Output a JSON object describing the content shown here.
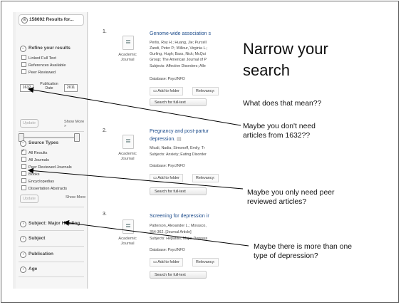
{
  "slide": {
    "headline_line1": "Narrow your",
    "headline_line2": "search",
    "question": "What does that mean??",
    "callouts": [
      {
        "line1": "Maybe you don't need",
        "line2": "articles from 1632??"
      },
      {
        "line1": "Maybe you only need peer",
        "line2": "reviewed articles?"
      },
      {
        "line1": "Maybe there is more than one",
        "line2": "type of depression?"
      }
    ]
  },
  "sidebar": {
    "results_count": "158692 Results for...",
    "refine_heading": "Refine your results",
    "refine_options": [
      {
        "label": "Linked Full Text",
        "checked": false
      },
      {
        "label": "References Available",
        "checked": false
      },
      {
        "label": "Peer Reviewed",
        "checked": false
      }
    ],
    "date_from": "1632",
    "date_label_line1": "Publication",
    "date_label_line2": "Date",
    "date_to": "2011",
    "update_label": "Update",
    "show_more_1": "Show More »",
    "source_types_heading": "Source Types",
    "source_types": [
      {
        "label": "All Results",
        "checked": true
      },
      {
        "label": "All Journals",
        "checked": false
      },
      {
        "label": "Peer Reviewed Journals",
        "checked": false
      },
      {
        "label": "Books",
        "checked": false
      },
      {
        "label": "Encyclopedias",
        "checked": false
      },
      {
        "label": "Dissertation Abstracts",
        "checked": false
      }
    ],
    "show_more_2": "Show More",
    "facets": [
      {
        "label": "Subject: Major Heading"
      },
      {
        "label": "Subject"
      },
      {
        "label": "Publication"
      },
      {
        "label": "Age"
      }
    ]
  },
  "results": [
    {
      "num": "1.",
      "type_line1": "Academic",
      "type_line2": "Journal",
      "title_line1": "Genome-wide association s",
      "meta_lines": [
        "Perlis, Roy H.; Huang, Jie; Purcell",
        "Zandi, Peter P.; Willour, Virginia L.;",
        "Gurling, Hugh; Bass, Nick; McQui",
        "Group; The American Journal of P",
        "Subjects: Affective Disorders; Alle"
      ],
      "database": "Database: PsycINFO",
      "add_folder": "Add to folder",
      "relevancy": "Relevancy:",
      "fulltext": "Search for full-text"
    },
    {
      "num": "2.",
      "type_line1": "Academic",
      "type_line2": "Journal",
      "title_line1": "Pregnancy and post-partur",
      "title_line2": "depression.",
      "meta_lines": [
        "Micali, Nadia; Simonoff, Emily; Tr",
        "Subjects: Anxiety; Eating Disorder"
      ],
      "database": "Database: PsycINFO",
      "add_folder": "Add to folder",
      "relevancy": "Relevancy:",
      "fulltext": "Search for full-text"
    },
    {
      "num": "3.",
      "type_line1": "Academic",
      "type_line2": "Journal",
      "title_line1": "Screening for depression ir",
      "meta_lines": [
        "Patterson, Alexander L.; Morasco,",
        "354-362. [Journal Article]",
        "Subjects: Hepatitis; Major Depress"
      ],
      "database": "Database: PsycINFO",
      "add_folder": "Add to folder",
      "relevancy": "Relevancy:",
      "fulltext": "Search for full-text"
    }
  ]
}
